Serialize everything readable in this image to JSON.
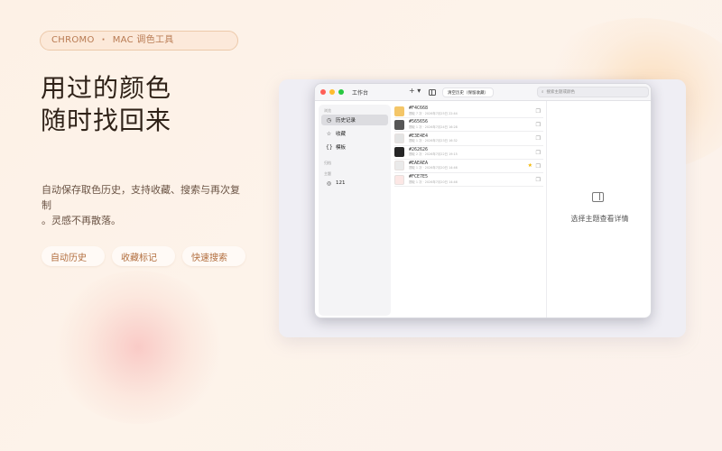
{
  "header": {
    "brand": "CHROMO",
    "separator": "·",
    "tagline": "MAC 调色工具"
  },
  "headline": {
    "line1": "用过的颜色",
    "line2": "随时找回来"
  },
  "description": {
    "line1": "自动保存取色历史，支持收藏、搜索与再次复制",
    "line2": "。灵感不再散落。"
  },
  "tags": [
    "自动历史",
    "收藏标记",
    "快速搜索"
  ],
  "colors": {
    "accent": "#b87a52",
    "star": "#f2b600"
  },
  "app": {
    "window_title": "工作台",
    "toolbar": {
      "add_label": "+ ▾",
      "clear_button": "清空历史（保留收藏）",
      "search_placeholder": "搜索主题或颜色"
    },
    "sidebar": {
      "section_browse": "浏览",
      "items": [
        {
          "label": "历史记录",
          "icon": "clock-icon"
        },
        {
          "label": "收藏",
          "icon": "star-icon"
        },
        {
          "label": "模板",
          "icon": "braces-icon"
        }
      ],
      "section_manage": "归档",
      "section_themes": "主题",
      "theme_items": [
        {
          "label": "121",
          "icon": "palette-icon"
        }
      ]
    },
    "history": [
      {
        "hex": "#F4C668",
        "meta": "提取 7 次 · 2026年7月25日 22:44",
        "favorite": false
      },
      {
        "hex": "#565656",
        "meta": "提取 1 次 · 2026年7月24日 16:28",
        "favorite": false
      },
      {
        "hex": "#E3E4E4",
        "meta": "提取 1 次 · 2026年7月23日 16:32",
        "favorite": false
      },
      {
        "hex": "#262626",
        "meta": "提取 2 次 · 2026年7月22日 19:15",
        "favorite": false
      },
      {
        "hex": "#EAEAEA",
        "meta": "提取 1 次 · 2026年7月20日 14:46",
        "favorite": true
      },
      {
        "hex": "#FCE7E5",
        "meta": "提取 1 次 · 2026年7月20日 14:46",
        "favorite": false
      }
    ],
    "detail_placeholder": "选择主题查看详情"
  }
}
